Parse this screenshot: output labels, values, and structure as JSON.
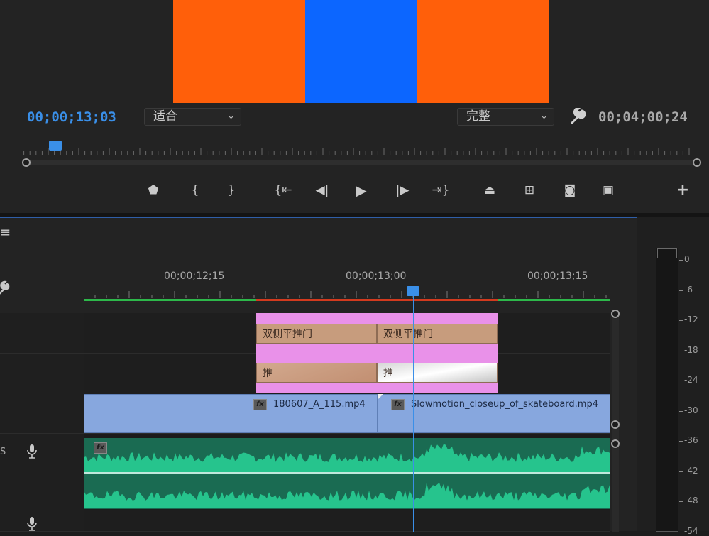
{
  "colors": {
    "orange": "#ff5f0a",
    "blue": "#0c66ff",
    "accent": "#3a8fe8",
    "transition_pink": "#e991e9",
    "transition_tan": "#c79c7d",
    "video_clip": "#87a7de",
    "audio_wave": "#26c48d",
    "audio_bg": "#1a6b52"
  },
  "monitor": {
    "current_timecode": "00;00;13;03",
    "fit_dropdown": "适合",
    "quality_dropdown": "完整",
    "duration_timecode": "00;04;00;24",
    "icons": [
      "marker-icon",
      "mark-in-icon",
      "mark-out-icon",
      "go-to-in-icon",
      "step-back-icon",
      "play-icon",
      "step-forward-icon",
      "go-to-out-icon",
      "lift-icon",
      "extract-icon",
      "export-frame-icon",
      "comparison-view-icon",
      "add-button-icon",
      "wrench-icon"
    ]
  },
  "timeline": {
    "menu_icon": "≡",
    "ruler_labels": [
      "00;00;12;15",
      "00;00;13;00",
      "00;00;13;15"
    ],
    "transitions": {
      "row1": [
        "双侧平推门",
        "双侧平推门"
      ],
      "row2": [
        "推",
        "推"
      ]
    },
    "video_clips": [
      {
        "name": "180607_A_115.mp4",
        "fx": "fx"
      },
      {
        "name": "Slowmotion_closeup_of_skateboard.mp4",
        "fx": "fx"
      }
    ],
    "audio_fx": "fx",
    "track_label": "S"
  },
  "meter": {
    "ticks": [
      "0",
      "-6",
      "-12",
      "-18",
      "-24",
      "-30",
      "-36",
      "-42",
      "-48",
      "-54"
    ]
  }
}
